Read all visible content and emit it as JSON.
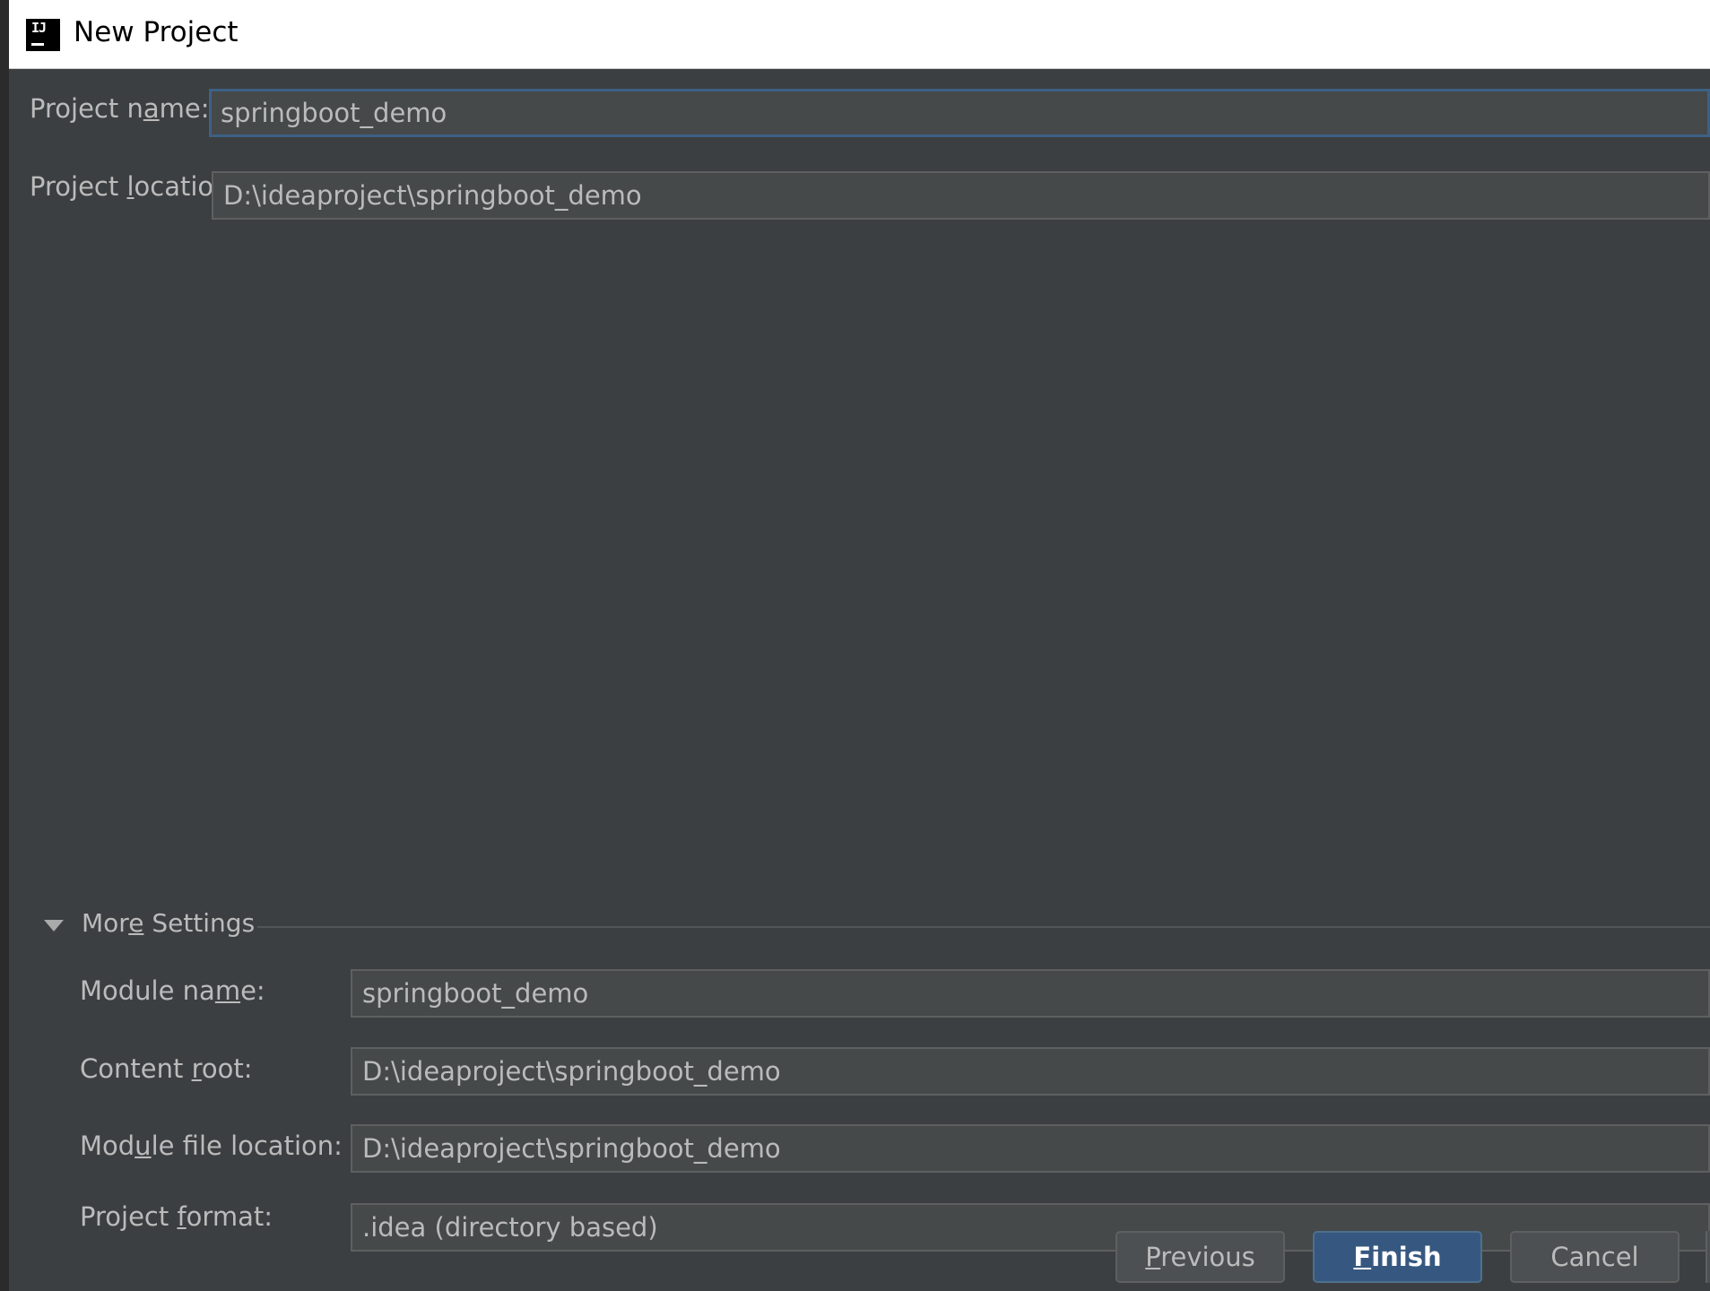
{
  "window": {
    "title": "New Project",
    "icon": "intellij-idea-icon"
  },
  "project": {
    "name_label_prefix": "Project n",
    "name_label_mnemonic": "a",
    "name_label_suffix": "me:",
    "name_value": "springboot_demo",
    "location_label_prefix": "Project ",
    "location_label_mnemonic": "l",
    "location_label_suffix": "ocation:",
    "location_value": "D:\\ideaproject\\springboot_demo"
  },
  "more_settings": {
    "label_prefix": "Mor",
    "label_mnemonic": "e",
    "label_suffix": " Settings",
    "expanded": true,
    "module_name_label_prefix": "Module na",
    "module_name_label_mnemonic": "m",
    "module_name_label_suffix": "e:",
    "module_name_value": "springboot_demo",
    "content_root_label_prefix": "Content ",
    "content_root_label_mnemonic": "r",
    "content_root_label_suffix": "oot:",
    "content_root_value": "D:\\ideaproject\\springboot_demo",
    "module_file_label_prefix": "Mod",
    "module_file_label_mnemonic": "u",
    "module_file_label_suffix": "le file location:",
    "module_file_value": "D:\\ideaproject\\springboot_demo",
    "project_format_label_prefix": "Project ",
    "project_format_label_mnemonic": "f",
    "project_format_label_suffix": "ormat:",
    "project_format_value": ".idea (directory based)"
  },
  "buttons": {
    "previous_mnemonic": "P",
    "previous_rest": "revious",
    "finish_mnemonic": "F",
    "finish_rest": "inish",
    "cancel": "Cancel"
  },
  "colors": {
    "dialog_bg": "#3c3f41",
    "field_bg": "#45494a",
    "focus_border": "#3d6185",
    "default_button": "#365880",
    "text": "#bbbbbb"
  }
}
